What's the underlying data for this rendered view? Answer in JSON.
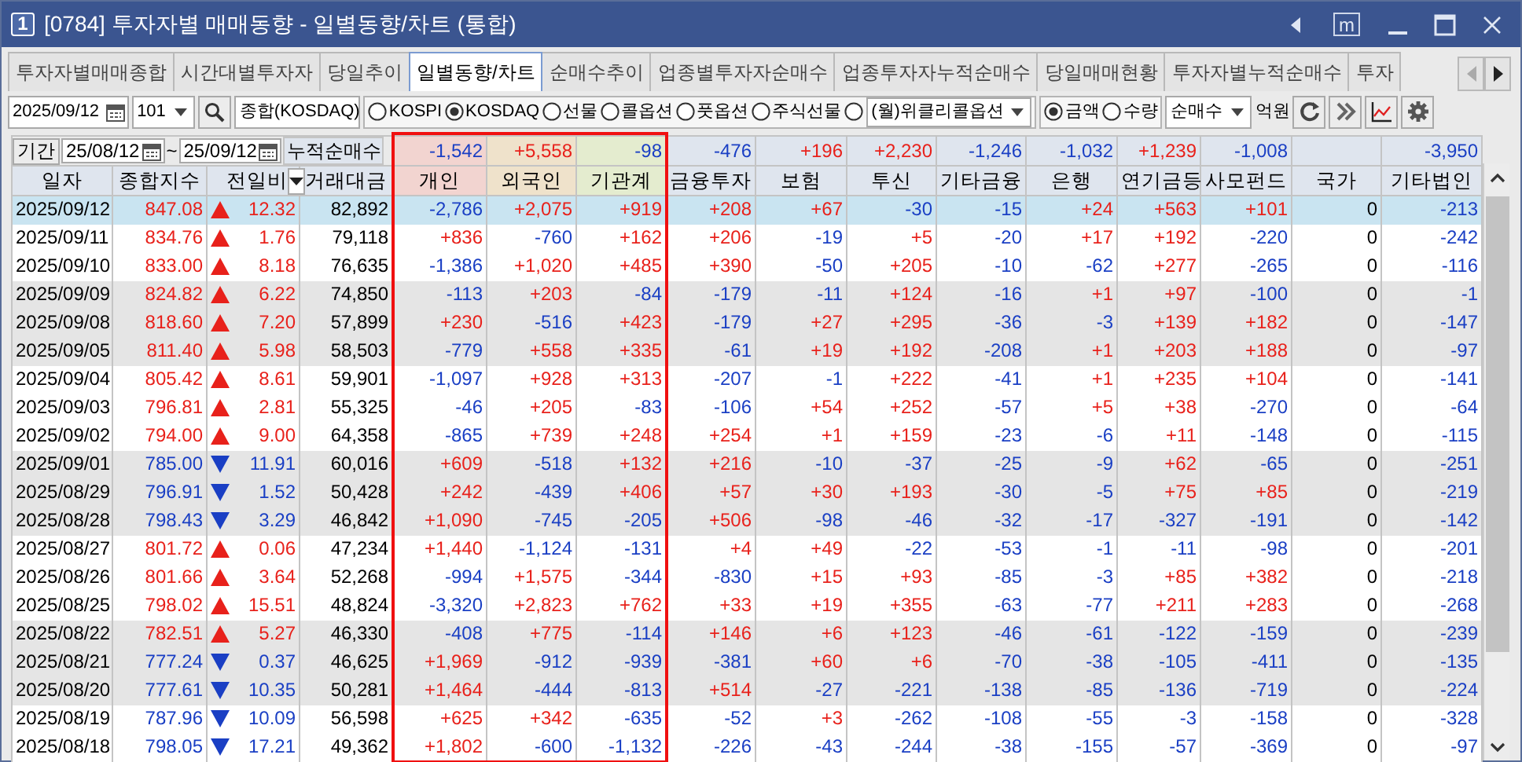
{
  "window": {
    "number": "1",
    "title": "[0784] 투자자별 매매동향 - 일별동향/차트 (통합)",
    "controls": [
      {
        "kind": "collapse"
      },
      {
        "kind": "memo",
        "label": "m"
      },
      {
        "kind": "minimize"
      },
      {
        "kind": "maximize"
      },
      {
        "kind": "close"
      }
    ]
  },
  "tabs": [
    {
      "label": "투자자별매매종합",
      "selected": false
    },
    {
      "label": "시간대별투자자",
      "selected": false
    },
    {
      "label": "당일추이",
      "selected": false
    },
    {
      "label": "일별동향/차트",
      "selected": true
    },
    {
      "label": "순매수추이",
      "selected": false
    },
    {
      "label": "업종별투자자순매수",
      "selected": false
    },
    {
      "label": "업종투자자누적순매수",
      "selected": false
    },
    {
      "label": "당일매매현황",
      "selected": false
    },
    {
      "label": "투자자별누적순매수",
      "selected": false
    },
    {
      "label": "투자",
      "selected": false
    }
  ],
  "toolbar": {
    "date": "2025/09/12",
    "code": "101",
    "name": "종합(KOSDAQ)",
    "markets": [
      {
        "kind": "radio",
        "label": "KOSPI",
        "selected": false
      },
      {
        "kind": "radio",
        "label": "KOSDAQ",
        "selected": true
      },
      {
        "kind": "radio",
        "label": "선물",
        "selected": false
      },
      {
        "kind": "radio",
        "label": "콜옵션",
        "selected": false
      },
      {
        "kind": "radio",
        "label": "풋옵션",
        "selected": false
      },
      {
        "kind": "radio",
        "label": "주식선물",
        "selected": false
      },
      {
        "kind": "dropdown",
        "value": "(월)위클리콜옵션",
        "selected": false
      }
    ],
    "units": [
      {
        "label": "금액",
        "selected": true
      },
      {
        "label": "수량",
        "selected": false
      }
    ],
    "mode": "순매수",
    "unit_label": "억원",
    "buttons": [
      {
        "kind": "refresh"
      },
      {
        "kind": "forward"
      },
      {
        "kind": "chart"
      },
      {
        "kind": "settings"
      }
    ]
  },
  "table": {
    "period": {
      "button": "기간",
      "from": "25/08/12",
      "separator": "~",
      "to": "25/09/12",
      "label": "누적순매수"
    },
    "columns": [
      {
        "kind": "date",
        "label": "일자"
      },
      {
        "kind": "index",
        "label": "종합지수"
      },
      {
        "kind": "change",
        "label": "전일비"
      },
      {
        "kind": "volume",
        "label": "거래대금"
      },
      {
        "kind": "investor",
        "label": "개인",
        "total": "-1,542",
        "color": "#f2d4d0",
        "highlighted": true
      },
      {
        "kind": "investor",
        "label": "외국인",
        "total": "+5,558",
        "color": "#efe2cb",
        "highlighted": true
      },
      {
        "kind": "investor",
        "label": "기관계",
        "total": "-98",
        "color": "#e4eccf",
        "highlighted": true
      },
      {
        "kind": "investor",
        "label": "금융투자",
        "total": "-476"
      },
      {
        "kind": "investor",
        "label": "보험",
        "total": "+196"
      },
      {
        "kind": "investor",
        "label": "투신",
        "total": "+2,230"
      },
      {
        "kind": "investor",
        "label": "기타금융",
        "total": "-1,246"
      },
      {
        "kind": "investor",
        "label": "은행",
        "total": "-1,032"
      },
      {
        "kind": "investor",
        "label": "연기금등",
        "total": "+1,239"
      },
      {
        "kind": "investor",
        "label": "사모펀드",
        "total": "-1,008"
      },
      {
        "kind": "investor",
        "label": "국가"
      },
      {
        "kind": "investor",
        "label": "기타법인",
        "total": "-3,950"
      }
    ],
    "rows": [
      {
        "date": "2025/09/12",
        "index": "847.08",
        "rising": true,
        "change": "12.32",
        "volume": "82,892",
        "values": [
          "-2,786",
          "+2,075",
          "+919",
          "+208",
          "+67",
          "-30",
          "-15",
          "+24",
          "+563",
          "+101",
          "0",
          "-213"
        ],
        "selected": true,
        "shaded": false
      },
      {
        "date": "2025/09/11",
        "index": "834.76",
        "rising": true,
        "change": "1.76",
        "volume": "79,118",
        "values": [
          "+836",
          "-760",
          "+162",
          "+206",
          "-19",
          "+5",
          "-20",
          "+17",
          "+192",
          "-220",
          "0",
          "-242"
        ],
        "selected": false,
        "shaded": false
      },
      {
        "date": "2025/09/10",
        "index": "833.00",
        "rising": true,
        "change": "8.18",
        "volume": "76,635",
        "values": [
          "-1,386",
          "+1,020",
          "+485",
          "+390",
          "-50",
          "+205",
          "-10",
          "-62",
          "+277",
          "-265",
          "0",
          "-116"
        ],
        "selected": false,
        "shaded": false
      },
      {
        "date": "2025/09/09",
        "index": "824.82",
        "rising": true,
        "change": "6.22",
        "volume": "74,850",
        "values": [
          "-113",
          "+203",
          "-84",
          "-179",
          "-11",
          "+124",
          "-16",
          "+1",
          "+97",
          "-100",
          "0",
          "-1"
        ],
        "selected": false,
        "shaded": true
      },
      {
        "date": "2025/09/08",
        "index": "818.60",
        "rising": true,
        "change": "7.20",
        "volume": "57,899",
        "values": [
          "+230",
          "-516",
          "+423",
          "-179",
          "+27",
          "+295",
          "-36",
          "-3",
          "+139",
          "+182",
          "0",
          "-147"
        ],
        "selected": false,
        "shaded": true
      },
      {
        "date": "2025/09/05",
        "index": "811.40",
        "rising": true,
        "change": "5.98",
        "volume": "58,503",
        "values": [
          "-779",
          "+558",
          "+335",
          "-61",
          "+19",
          "+192",
          "-208",
          "+1",
          "+203",
          "+188",
          "0",
          "-97"
        ],
        "selected": false,
        "shaded": true
      },
      {
        "date": "2025/09/04",
        "index": "805.42",
        "rising": true,
        "change": "8.61",
        "volume": "59,901",
        "values": [
          "-1,097",
          "+928",
          "+313",
          "-207",
          "-1",
          "+222",
          "-41",
          "+1",
          "+235",
          "+104",
          "0",
          "-141"
        ],
        "selected": false,
        "shaded": false
      },
      {
        "date": "2025/09/03",
        "index": "796.81",
        "rising": true,
        "change": "2.81",
        "volume": "55,325",
        "values": [
          "-46",
          "+205",
          "-83",
          "-106",
          "+54",
          "+252",
          "-57",
          "+5",
          "+38",
          "-270",
          "0",
          "-64"
        ],
        "selected": false,
        "shaded": false
      },
      {
        "date": "2025/09/02",
        "index": "794.00",
        "rising": true,
        "change": "9.00",
        "volume": "64,358",
        "values": [
          "-865",
          "+739",
          "+248",
          "+254",
          "+1",
          "+159",
          "-23",
          "-6",
          "+11",
          "-148",
          "0",
          "-115"
        ],
        "selected": false,
        "shaded": false
      },
      {
        "date": "2025/09/01",
        "index": "785.00",
        "rising": false,
        "change": "11.91",
        "volume": "60,016",
        "values": [
          "+609",
          "-518",
          "+132",
          "+216",
          "-10",
          "-37",
          "-25",
          "-9",
          "+62",
          "-65",
          "0",
          "-251"
        ],
        "selected": false,
        "shaded": true
      },
      {
        "date": "2025/08/29",
        "index": "796.91",
        "rising": false,
        "change": "1.52",
        "volume": "50,428",
        "values": [
          "+242",
          "-439",
          "+406",
          "+57",
          "+30",
          "+193",
          "-30",
          "-5",
          "+75",
          "+85",
          "0",
          "-219"
        ],
        "selected": false,
        "shaded": true
      },
      {
        "date": "2025/08/28",
        "index": "798.43",
        "rising": false,
        "change": "3.29",
        "volume": "46,842",
        "values": [
          "+1,090",
          "-745",
          "-205",
          "+506",
          "-98",
          "-46",
          "-32",
          "-17",
          "-327",
          "-191",
          "0",
          "-142"
        ],
        "selected": false,
        "shaded": true
      },
      {
        "date": "2025/08/27",
        "index": "801.72",
        "rising": true,
        "change": "0.06",
        "volume": "47,234",
        "values": [
          "+1,440",
          "-1,124",
          "-131",
          "+4",
          "+49",
          "-22",
          "-53",
          "-1",
          "-11",
          "-98",
          "0",
          "-201"
        ],
        "selected": false,
        "shaded": false
      },
      {
        "date": "2025/08/26",
        "index": "801.66",
        "rising": true,
        "change": "3.64",
        "volume": "52,268",
        "values": [
          "-994",
          "+1,575",
          "-344",
          "-830",
          "+15",
          "+93",
          "-85",
          "-3",
          "+85",
          "+382",
          "0",
          "-218"
        ],
        "selected": false,
        "shaded": false
      },
      {
        "date": "2025/08/25",
        "index": "798.02",
        "rising": true,
        "change": "15.51",
        "volume": "48,824",
        "values": [
          "-3,320",
          "+2,823",
          "+762",
          "+33",
          "+19",
          "+355",
          "-63",
          "-77",
          "+211",
          "+283",
          "0",
          "-268"
        ],
        "selected": false,
        "shaded": false
      },
      {
        "date": "2025/08/22",
        "index": "782.51",
        "rising": true,
        "change": "5.27",
        "volume": "46,330",
        "values": [
          "-408",
          "+775",
          "-114",
          "+146",
          "+6",
          "+123",
          "-46",
          "-61",
          "-122",
          "-159",
          "0",
          "-239"
        ],
        "selected": false,
        "shaded": true
      },
      {
        "date": "2025/08/21",
        "index": "777.24",
        "rising": false,
        "change": "0.37",
        "volume": "46,625",
        "values": [
          "+1,969",
          "-912",
          "-939",
          "-381",
          "+60",
          "+6",
          "-70",
          "-38",
          "-105",
          "-411",
          "0",
          "-135"
        ],
        "selected": false,
        "shaded": true
      },
      {
        "date": "2025/08/20",
        "index": "777.61",
        "rising": false,
        "change": "10.35",
        "volume": "50,281",
        "values": [
          "+1,464",
          "-444",
          "-813",
          "+514",
          "-27",
          "-221",
          "-138",
          "-85",
          "-136",
          "-719",
          "0",
          "-224"
        ],
        "selected": false,
        "shaded": true
      },
      {
        "date": "2025/08/19",
        "index": "787.96",
        "rising": false,
        "change": "10.09",
        "volume": "56,598",
        "values": [
          "+625",
          "+342",
          "-635",
          "-52",
          "+3",
          "-262",
          "-108",
          "-55",
          "-3",
          "-158",
          "0",
          "-328"
        ],
        "selected": false,
        "shaded": false
      },
      {
        "date": "2025/08/18",
        "index": "798.05",
        "rising": false,
        "change": "17.21",
        "volume": "49,362",
        "values": [
          "+1,802",
          "-600",
          "-1,132",
          "-226",
          "-43",
          "-244",
          "-38",
          "-155",
          "-57",
          "-369",
          "0",
          "-97"
        ],
        "selected": false,
        "shaded": false
      }
    ]
  }
}
